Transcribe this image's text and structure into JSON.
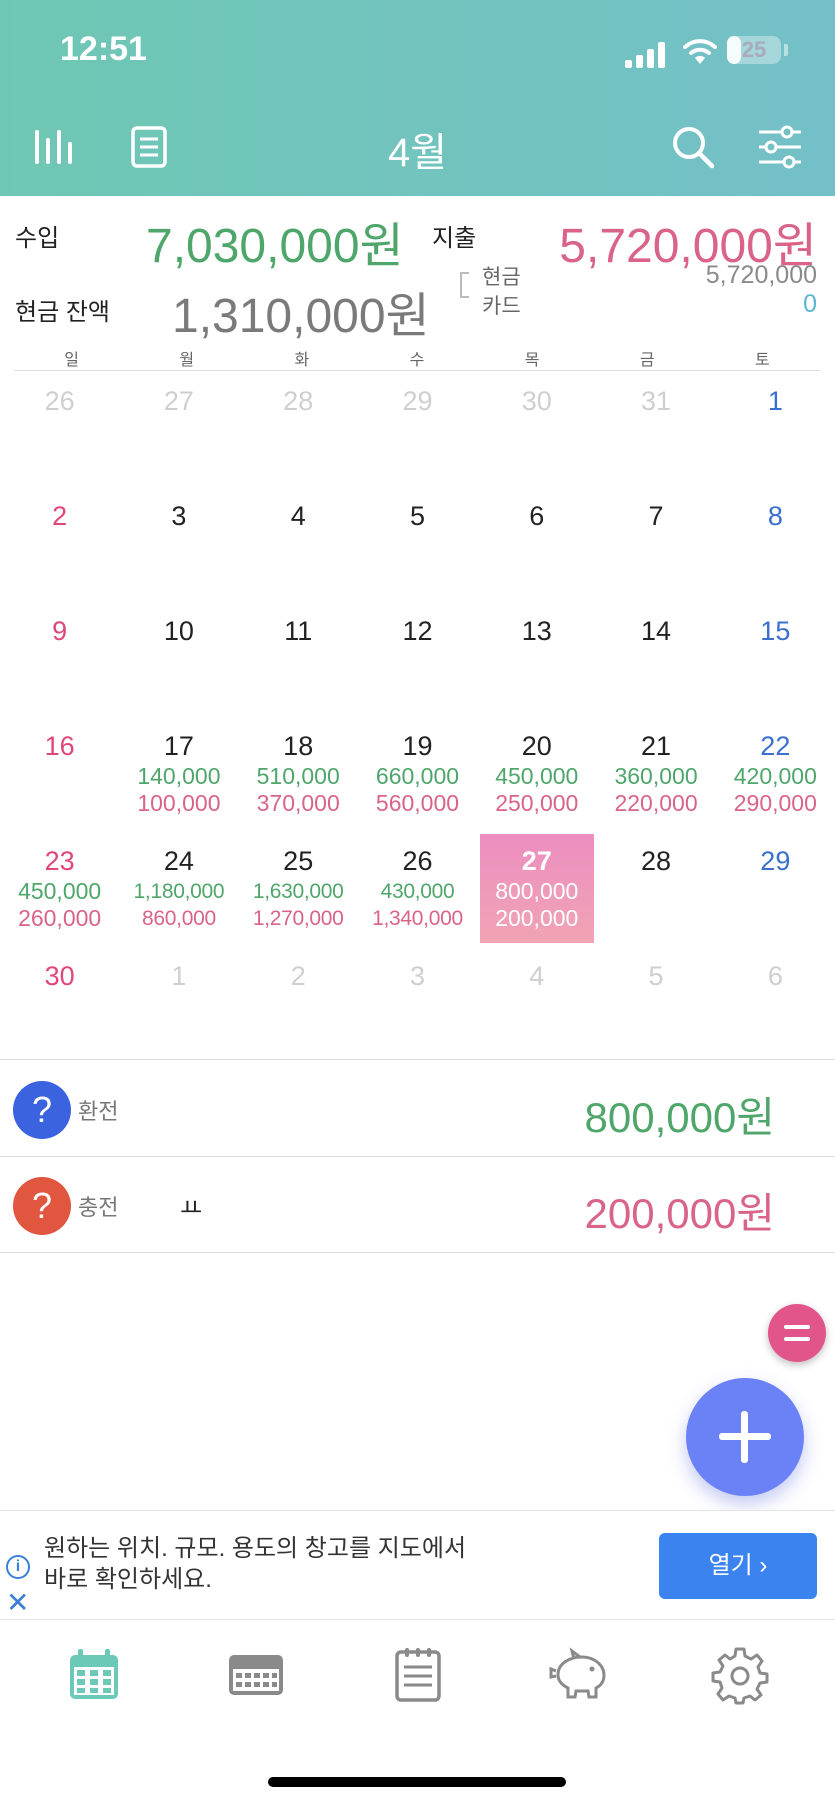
{
  "status": {
    "time": "12:51",
    "battery": "25",
    "battery_level_percent": 25
  },
  "header": {
    "title": "4월",
    "icons": [
      "stats-icon",
      "list-icon",
      "search-icon",
      "filter-icon"
    ]
  },
  "summary": {
    "income_label": "수입",
    "income_value": "7,030,000원",
    "expense_label": "지출",
    "expense_value": "5,720,000원",
    "balance_label": "현금 잔액",
    "balance_value": "1,310,000원",
    "cash_label": "현금",
    "cash_value": "5,720,000",
    "card_label": "카드",
    "card_value": "0"
  },
  "calendar": {
    "weekdays": [
      "일",
      "월",
      "화",
      "수",
      "목",
      "금",
      "토"
    ],
    "weeks": [
      [
        {
          "d": "26",
          "m": true
        },
        {
          "d": "27",
          "m": true
        },
        {
          "d": "28",
          "m": true
        },
        {
          "d": "29",
          "m": true
        },
        {
          "d": "30",
          "m": true
        },
        {
          "d": "31",
          "m": true
        },
        {
          "d": "1"
        }
      ],
      [
        {
          "d": "2"
        },
        {
          "d": "3"
        },
        {
          "d": "4"
        },
        {
          "d": "5"
        },
        {
          "d": "6"
        },
        {
          "d": "7"
        },
        {
          "d": "8"
        }
      ],
      [
        {
          "d": "9"
        },
        {
          "d": "10"
        },
        {
          "d": "11"
        },
        {
          "d": "12"
        },
        {
          "d": "13"
        },
        {
          "d": "14"
        },
        {
          "d": "15"
        }
      ],
      [
        {
          "d": "16"
        },
        {
          "d": "17",
          "inc": "140,000",
          "exp": "100,000"
        },
        {
          "d": "18",
          "inc": "510,000",
          "exp": "370,000"
        },
        {
          "d": "19",
          "inc": "660,000",
          "exp": "560,000"
        },
        {
          "d": "20",
          "inc": "450,000",
          "exp": "250,000"
        },
        {
          "d": "21",
          "inc": "360,000",
          "exp": "220,000"
        },
        {
          "d": "22",
          "inc": "420,000",
          "exp": "290,000"
        }
      ],
      [
        {
          "d": "23",
          "inc": "450,000",
          "exp": "260,000"
        },
        {
          "d": "24",
          "inc": "1,180,000",
          "exp": "860,000"
        },
        {
          "d": "25",
          "inc": "1,630,000",
          "exp": "1,270,000"
        },
        {
          "d": "26",
          "inc": "430,000",
          "exp": "1,340,000"
        },
        {
          "d": "27",
          "inc": "800,000",
          "exp": "200,000",
          "today": true
        },
        {
          "d": "28"
        },
        {
          "d": "29"
        }
      ],
      [
        {
          "d": "30"
        },
        {
          "d": "1",
          "m": true
        },
        {
          "d": "2",
          "m": true
        },
        {
          "d": "3",
          "m": true
        },
        {
          "d": "4",
          "m": true
        },
        {
          "d": "5",
          "m": true
        },
        {
          "d": "6",
          "m": true
        }
      ]
    ]
  },
  "transactions": [
    {
      "icon": "?",
      "category": "환전",
      "memo": "",
      "amount": "800,000원",
      "type": "income",
      "color": "#3b63e0"
    },
    {
      "icon": "?",
      "category": "충전",
      "memo": "ㅛ",
      "amount": "200,000원",
      "type": "expense",
      "color": "#e0563f"
    }
  ],
  "ad": {
    "text_line1": "원하는 위치. 규모. 용도의 창고를 지도에서",
    "text_line2": "바로 확인하세요.",
    "button": "열기 ›",
    "info_icon": "i",
    "close_icon": "✕"
  },
  "tabs": [
    "calendar-tab-icon",
    "weekly-tab-icon",
    "notes-tab-icon",
    "piggybank-tab-icon",
    "settings-tab-icon"
  ],
  "colors": {
    "accent": "#6fc7b3",
    "income": "#4fa66a",
    "expense": "#d96487",
    "fab": "#6b82f6",
    "today": "#ec8ec0"
  }
}
